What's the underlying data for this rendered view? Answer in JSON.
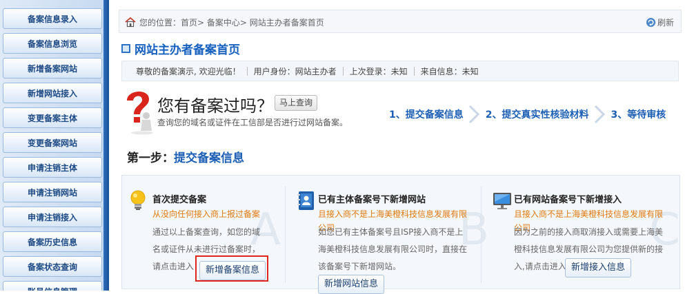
{
  "sidebar": {
    "items": [
      {
        "label": "备案信息录入"
      },
      {
        "label": "备案信息浏览"
      },
      {
        "label": "新增备案网站"
      },
      {
        "label": "新增网站接入"
      },
      {
        "label": "变更备案主体"
      },
      {
        "label": "变更备案网站"
      },
      {
        "label": "申请注销主体"
      },
      {
        "label": "申请注销网站"
      },
      {
        "label": "申请注销接入"
      },
      {
        "label": "备案历史信息"
      },
      {
        "label": "备案状态查询"
      },
      {
        "label": "账号信息管理"
      }
    ]
  },
  "breadcrumb": {
    "prefix": "您的位置：",
    "path": "首页> 备案中心> 网站主办者备案首页",
    "refresh_label": "刷新"
  },
  "page": {
    "title": "网站主办者备案首页"
  },
  "info_bar": {
    "greeting": "尊敬的备案演示, 欢迎光临！",
    "identity": "用户身份：网站主办者",
    "last_login": "上次登录：未知",
    "source": "来自信息：未知"
  },
  "question": {
    "title": "您有备案过吗？",
    "quick_button": "马上查询",
    "subtitle": "查询您的域名或证件在工信部是否进行过网站备案。"
  },
  "steps": [
    {
      "label": "1、提交备案信息"
    },
    {
      "label": "2、提交真实性核验材料"
    },
    {
      "label": "3、等待审核"
    }
  ],
  "step1": {
    "label": "第一步：",
    "value": "提交备案信息"
  },
  "options": [
    {
      "ghost": "A",
      "icon": "lightbulb-icon",
      "title": "首次提交备案",
      "subtitle": "从没向任何接入商上报过备案",
      "desc": "通过以上备案查询，如您的域名或证件从未进行过备案时，请点击进入",
      "button": "新增备案信息"
    },
    {
      "ghost": "B",
      "icon": "address-book-icon",
      "title": "已有主体备案号下新增网站",
      "subtitle": "且接入商不是上海美橙科技信息发展有限公司",
      "desc": "如您已有主体备案号且ISP接入商不是上海美橙科技信息发展有限公司时，直接在该备案号下新增网站。",
      "button": "新增网站信息"
    },
    {
      "ghost": "C",
      "icon": "monitor-icon",
      "title": "已有网站备案号下新增接入",
      "subtitle": "且接入商不是上海美橙科技信息发展有限公司",
      "desc": "因为之前的接入商取消接入或需要上海美橙科技信息发展有限公司为您提供新的接入,请点击进入",
      "button": "新增接入信息"
    }
  ],
  "colors": {
    "accent": "#1d5fb4",
    "orange": "#e07a10",
    "highlight": "#e0261c"
  }
}
